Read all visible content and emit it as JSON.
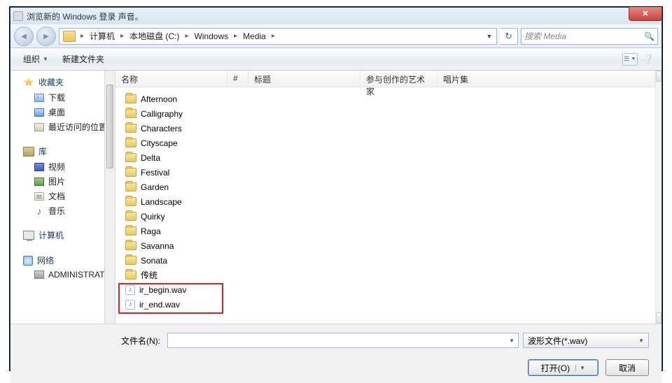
{
  "window": {
    "title": "浏览新的 Windows 登录 声音。"
  },
  "breadcrumb": {
    "items": [
      "计算机",
      "本地磁盘 (C:)",
      "Windows",
      "Media"
    ]
  },
  "search": {
    "placeholder": "搜索 Media"
  },
  "toolbar": {
    "organize": "组织",
    "newfolder": "新建文件夹"
  },
  "sidebar": {
    "favorites": {
      "label": "收藏夹",
      "items": [
        {
          "label": "下载",
          "icon": "dlico"
        },
        {
          "label": "桌面",
          "icon": "deskico"
        },
        {
          "label": "最近访问的位置",
          "icon": "recentico"
        }
      ]
    },
    "libraries": {
      "label": "库",
      "items": [
        {
          "label": "视频",
          "icon": "vidico"
        },
        {
          "label": "图片",
          "icon": "picico"
        },
        {
          "label": "文档",
          "icon": "docico"
        },
        {
          "label": "音乐",
          "icon": "musico",
          "glyph": "♪"
        }
      ]
    },
    "computer": {
      "label": "计算机"
    },
    "network": {
      "label": "网络",
      "items": [
        {
          "label": "ADMINISTRATO",
          "icon": "adminico"
        }
      ]
    }
  },
  "columns": {
    "name": "名称",
    "num": "#",
    "title": "标题",
    "artist": "参与创作的艺术家",
    "album": "唱片集"
  },
  "files": {
    "folders": [
      "Afternoon",
      "Calligraphy",
      "Characters",
      "Cityscape",
      "Delta",
      "Festival",
      "Garden",
      "Landscape",
      "Quirky",
      "Raga",
      "Savanna",
      "Sonata",
      "传统"
    ],
    "wavs": [
      "ir_begin.wav",
      "ir_end.wav"
    ]
  },
  "bottom": {
    "filename_label": "文件名(N):",
    "filter": "波形文件(*.wav)",
    "open": "打开(O)",
    "cancel": "取消"
  }
}
